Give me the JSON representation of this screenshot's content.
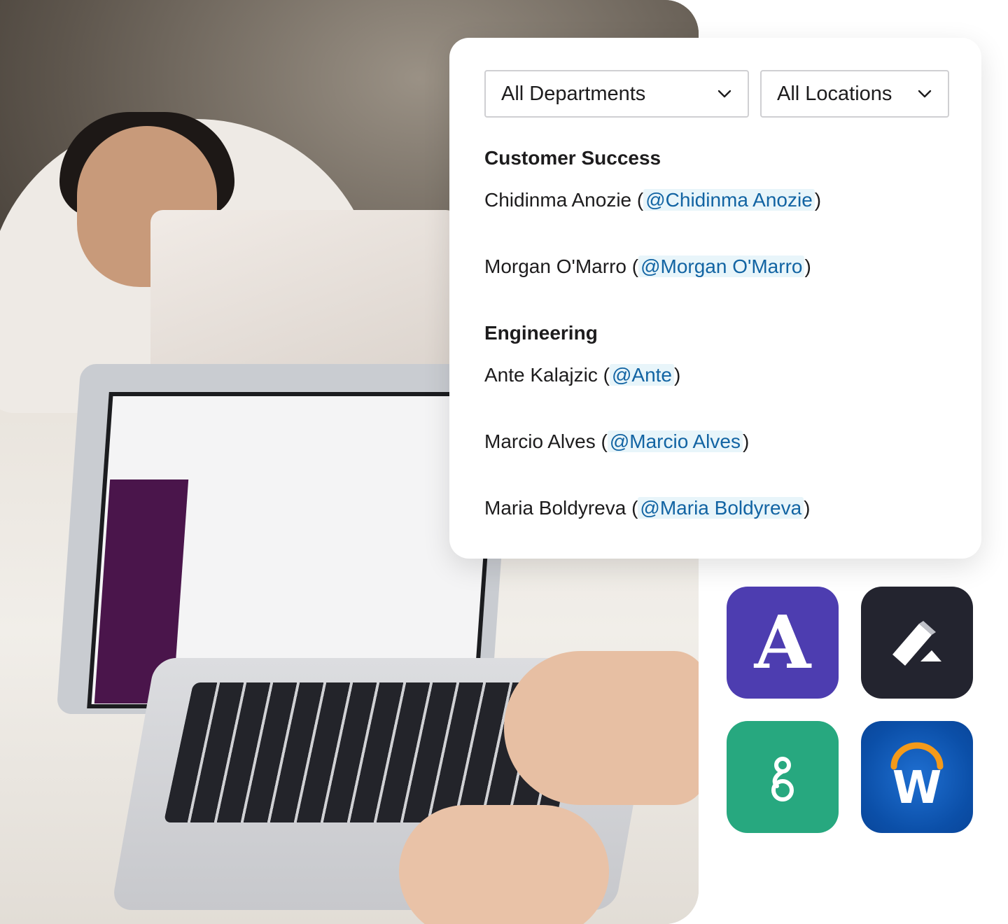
{
  "filters": {
    "department": {
      "selected": "All Departments"
    },
    "location": {
      "selected": "All Locations"
    }
  },
  "directory": {
    "groups": [
      {
        "title": "Customer Success",
        "people": [
          {
            "name": "Chidinma Anozie",
            "handle": "@Chidinma Anozie"
          },
          {
            "name": "Morgan O'Marro",
            "handle": "@Morgan O'Marro"
          }
        ]
      },
      {
        "title": "Engineering",
        "people": [
          {
            "name": "Ante Kalajzic",
            "handle": "@Ante"
          },
          {
            "name": "Marcio Alves",
            "handle": "@Marcio Alves"
          },
          {
            "name": "Maria Boldyreva",
            "handle": "@Maria Boldyreva"
          }
        ]
      }
    ]
  },
  "apps": {
    "a_letter": "A",
    "w_letter": "W",
    "colors": {
      "purple": "#4d3db0",
      "dark": "#23242f",
      "green": "#27a87f",
      "blue": "#0b4fa8",
      "orange": "#f49a1a"
    }
  },
  "icons": {
    "chevron": "chevron-down-icon",
    "app1": "a-logo-icon",
    "app2": "pen-logo-icon",
    "app3": "g-logo-icon",
    "app4": "w-logo-icon"
  }
}
